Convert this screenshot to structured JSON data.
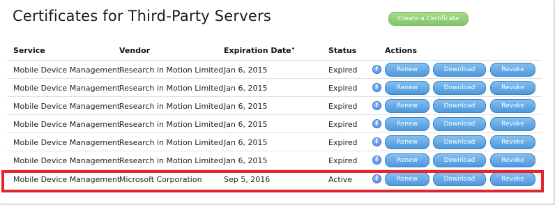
{
  "page": {
    "title": "Certificates for Third-Party Servers",
    "create_button_label": "Create a Certificate"
  },
  "table": {
    "columns": {
      "service": "Service",
      "vendor": "Vendor",
      "expiration_date": "Expiration Date",
      "expiration_sort_marker": "▾",
      "status": "Status",
      "actions": "Actions"
    },
    "action_labels": {
      "renew": "Renew",
      "download": "Download",
      "revoke": "Revoke"
    },
    "info_icon_glyph": "i",
    "rows": [
      {
        "service": "Mobile Device Management",
        "vendor": "Research in Motion Limited",
        "expiration_date": "Jan 6, 2015",
        "status": "Expired"
      },
      {
        "service": "Mobile Device Management",
        "vendor": "Research in Motion Limited",
        "expiration_date": "Jan 6, 2015",
        "status": "Expired"
      },
      {
        "service": "Mobile Device Management",
        "vendor": "Research in Motion Limited",
        "expiration_date": "Jan 6, 2015",
        "status": "Expired"
      },
      {
        "service": "Mobile Device Management",
        "vendor": "Research in Motion Limited",
        "expiration_date": "Jan 6, 2015",
        "status": "Expired"
      },
      {
        "service": "Mobile Device Management",
        "vendor": "Research in Motion Limited",
        "expiration_date": "Jan 6, 2015",
        "status": "Expired"
      },
      {
        "service": "Mobile Device Management",
        "vendor": "Research in Motion Limited",
        "expiration_date": "Jan 6, 2015",
        "status": "Expired"
      },
      {
        "service": "Mobile Device Management",
        "vendor": "Microsoft Corporation",
        "expiration_date": "Sep 5, 2016",
        "status": "Active"
      }
    ]
  },
  "colors": {
    "create_button": "#82c667",
    "action_button": "#4c98de",
    "highlight_border": "#e8232a"
  }
}
